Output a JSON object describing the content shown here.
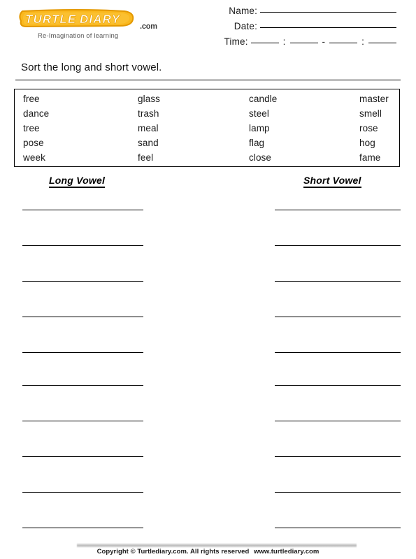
{
  "brand": {
    "logo_text_1": "TURTLE",
    "logo_text_2": "DIARY",
    "dotcom": ".com",
    "tagline": "Re-Imagination of learning",
    "logo_fill": "#FAB81E",
    "logo_stroke": "#E39800",
    "logo_letter_color": "#FFFFFF"
  },
  "header": {
    "name_label": "Name:",
    "date_label": "Date:",
    "time_label": "Time:",
    "blank": "",
    "time_separator_1": ":",
    "time_separator_2": "-",
    "time_separator_3": ":"
  },
  "instruction": "Sort the long and short vowel.",
  "word_bank": {
    "columns": [
      [
        "free",
        "dance",
        "tree",
        "pose",
        "week"
      ],
      [
        "glass",
        "trash",
        "meal",
        "sand",
        "feel"
      ],
      [
        "candle",
        "steel",
        "lamp",
        "flag",
        "close"
      ],
      [
        "master",
        "smell",
        "rose",
        "hog",
        "fame"
      ]
    ],
    "rows": [
      [
        "free",
        "glass",
        "candle",
        "master"
      ],
      [
        "dance",
        "trash",
        "steel",
        "smell"
      ],
      [
        "tree",
        "meal",
        "lamp",
        "rose"
      ],
      [
        "pose",
        "sand",
        "flag",
        "hog"
      ],
      [
        "week",
        "feel",
        "close",
        "fame"
      ]
    ]
  },
  "sort_columns": {
    "long_label": "Long Vowel",
    "short_label": "Short Vowel",
    "answer_line_count": 10,
    "line_tops": [
      300,
      351,
      402,
      453,
      504,
      551,
      602,
      653,
      704,
      755
    ]
  },
  "footer": {
    "copyright": "Copyright © Turtlediary.com. All rights reserved",
    "url": "www.turtlediary.com"
  }
}
